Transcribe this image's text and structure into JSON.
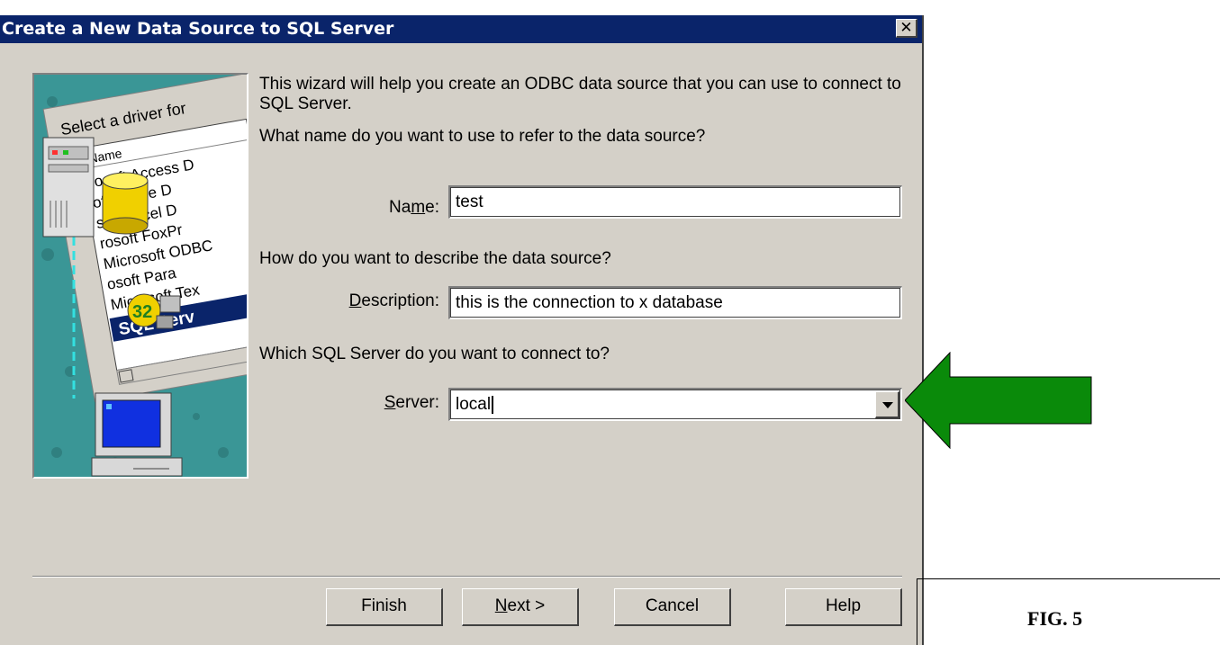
{
  "dialog": {
    "title": "Create a New Data Source to SQL Server",
    "close_label": "✕"
  },
  "art": {
    "header_text": "Select a driver for",
    "list_header": "Name",
    "driver_items": [
      "rosoft Access D",
      "oft dBase D",
      "soft Excel D",
      "rosoft FoxPr",
      "Microsoft ODBC",
      "osoft Para",
      "Microsoft Tex",
      "SQL Serv"
    ],
    "badge": "32"
  },
  "wizard": {
    "intro": "This wizard will help you create an ODBC data source that you can use to connect to SQL Server.",
    "q_name": "What name do you want to use to refer to the data source?",
    "name_label_pre": "Na",
    "name_label_acc": "m",
    "name_label_post": "e:",
    "name_value": "test",
    "q_desc": "How do you want to describe the data source?",
    "desc_label_acc": "D",
    "desc_label_post": "escription:",
    "desc_value": "this is the connection to x database",
    "q_server": "Which SQL Server do you want to connect to?",
    "server_label_acc": "S",
    "server_label_post": "erver:",
    "server_value": "local"
  },
  "buttons": {
    "finish": "Finish",
    "next_acc": "N",
    "next_post": "ext >",
    "cancel": "Cancel",
    "help": "Help"
  },
  "annotation": {
    "arrow_color": "#0a8a0a",
    "figure_label": "FIG. 5"
  }
}
